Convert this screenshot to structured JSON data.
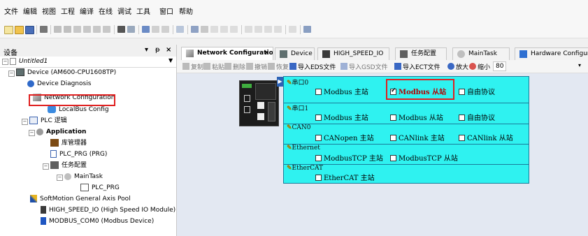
{
  "menubar": {
    "items": [
      "文件",
      "编辑",
      "视图",
      "工程",
      "编译",
      "在线",
      "调试",
      "工具",
      "窗口",
      "帮助"
    ]
  },
  "left_pane": {
    "title": "设备",
    "controls": [
      "▾",
      "ᵽ",
      "×"
    ],
    "tree": [
      {
        "label": "Untitled1",
        "icon": "project-icon",
        "italic": true
      },
      {
        "label": "Device (AM600-CPU1608TP)",
        "icon": "device-icon"
      },
      {
        "label": "Device Diagnosis",
        "icon": "diagnosis-icon"
      },
      {
        "label": "Network Configuration",
        "icon": "network-config-icon"
      },
      {
        "label": "LocalBus Config",
        "icon": "localbus-icon"
      },
      {
        "label": "PLC 逻辑",
        "icon": "plc-logic-icon"
      },
      {
        "label": "Application",
        "icon": "application-icon",
        "bold": true
      },
      {
        "label": "库管理器",
        "icon": "library-manager-icon"
      },
      {
        "label": "PLC_PRG (PRG)",
        "icon": "pou-icon"
      },
      {
        "label": "任务配置",
        "icon": "task-config-icon"
      },
      {
        "label": "MainTask",
        "icon": "task-icon"
      },
      {
        "label": "PLC_PRG",
        "icon": "program-call-icon"
      },
      {
        "label": "SoftMotion General Axis Pool",
        "icon": "axis-pool-icon"
      },
      {
        "label": "HIGH_SPEED_IO (High Speed IO Module)",
        "icon": "io-module-icon"
      },
      {
        "label": "MODBUS_COM0 (Modbus Device)",
        "icon": "modbus-device-icon"
      }
    ]
  },
  "tabs": [
    {
      "label": "Network Configuration",
      "active": true,
      "icon": "network-config-icon"
    },
    {
      "label": "Device",
      "icon": "device-icon"
    },
    {
      "label": "HIGH_SPEED_IO",
      "icon": "io-module-icon"
    },
    {
      "label": "任务配置",
      "icon": "task-config-icon"
    },
    {
      "label": "MainTask",
      "icon": "task-icon"
    },
    {
      "label": "Hardware Configurat",
      "icon": "hardware-config-icon"
    }
  ],
  "editor_toolbar": {
    "items": [
      "复制",
      "粘贴",
      "删除",
      "撤销",
      "恢复",
      "导入EDS文件",
      "导入GSD文件",
      "导入ECT文件",
      "放大",
      "缩小"
    ],
    "zoom": "80"
  },
  "protocols": [
    {
      "label": "串口0",
      "options": [
        {
          "label": "Modbus 主站",
          "checked": false
        },
        {
          "label": "Modbus 从站",
          "checked": true,
          "emphasized": true
        },
        {
          "label": "自由协议",
          "checked": false
        }
      ]
    },
    {
      "label": "串口1",
      "options": [
        {
          "label": "Modbus 主站",
          "checked": false
        },
        {
          "label": "Modbus 从站",
          "checked": false
        },
        {
          "label": "自由协议",
          "checked": false
        }
      ]
    },
    {
      "label": "CAN0",
      "options": [
        {
          "label": "CANopen 主站",
          "checked": false
        },
        {
          "label": "CANlink 主站",
          "checked": false
        },
        {
          "label": "CANlink 从站",
          "checked": false
        }
      ]
    },
    {
      "label": "Ethernet",
      "options": [
        {
          "label": "ModbusTCP 主站",
          "checked": false
        },
        {
          "label": "ModbusTCP 从站",
          "checked": false
        }
      ]
    },
    {
      "label": "EtherCAT",
      "options": [
        {
          "label": "EtherCAT 主站",
          "checked": false
        }
      ]
    }
  ],
  "colors": {
    "protocol_panel": "#2ff2f0",
    "highlight": "#e02020",
    "canvas": "#e3e8f2"
  }
}
